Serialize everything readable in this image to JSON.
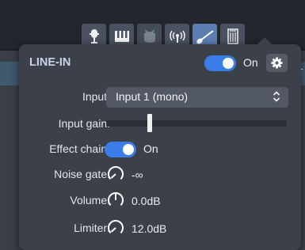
{
  "toolbar": {
    "buttons": [
      {
        "name": "microphone-icon",
        "active": false
      },
      {
        "name": "piano-keys-icon",
        "active": false
      },
      {
        "name": "drum-icon",
        "active": false
      },
      {
        "name": "broadcast-icon",
        "active": false
      },
      {
        "name": "guitar-icon",
        "active": true
      },
      {
        "name": "amp-icon",
        "active": false
      }
    ]
  },
  "panel": {
    "title": "LINE-IN",
    "power_toggle_label": "On",
    "power_on": true,
    "input_label": "Input:",
    "input_value": "Input 1 (mono)",
    "input_gain_label": "Input gain:",
    "input_gain_level": 0.24,
    "effect_chain_label": "Effect chain:",
    "effect_chain_toggle_label": "On",
    "effect_chain_on": true,
    "noise_gate_label": "Noise gate:",
    "noise_gate_value": "-∞",
    "volume_label": "Volume:",
    "volume_value": "0.0dB",
    "limiter_label": "Limiter:",
    "limiter_value": "12.0dB"
  },
  "colors": {
    "accent": "#3b7de8",
    "panel_bg": "#3c4049",
    "title": "#c7d3e6"
  }
}
